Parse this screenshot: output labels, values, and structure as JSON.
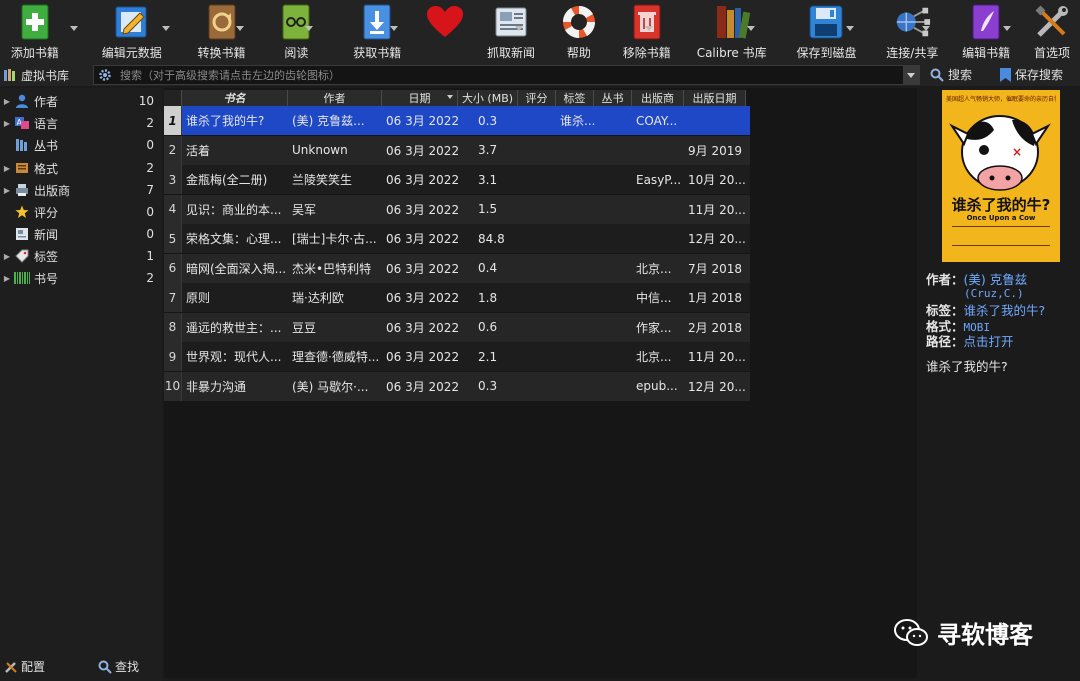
{
  "toolbar": {
    "items": [
      {
        "label": "添加书籍",
        "icon": "add-book-icon"
      },
      {
        "label": "编辑元数据",
        "icon": "edit-metadata-icon"
      },
      {
        "label": "转换书籍",
        "icon": "convert-book-icon"
      },
      {
        "label": "阅读",
        "icon": "read-book-icon"
      },
      {
        "label": "获取书籍",
        "icon": "get-books-icon"
      },
      {
        "label": "",
        "icon": "donate-heart-icon"
      },
      {
        "label": "抓取新闻",
        "icon": "fetch-news-icon"
      },
      {
        "label": "帮助",
        "icon": "help-lifebuoy-icon"
      },
      {
        "label": "移除书籍",
        "icon": "remove-books-icon"
      },
      {
        "label": "Calibre 书库",
        "icon": "calibre-library-icon"
      },
      {
        "label": "保存到磁盘",
        "icon": "save-to-disk-icon"
      },
      {
        "label": "连接/共享",
        "icon": "connect-share-icon"
      },
      {
        "label": "编辑书籍",
        "icon": "edit-book-icon"
      },
      {
        "label": "首选项",
        "icon": "preferences-icon"
      }
    ]
  },
  "search": {
    "virtual_library_label": "虚拟书库",
    "placeholder": "搜索（对于高级搜索请点击左边的齿轮图标）",
    "search_label": "搜索",
    "saved_search_label": "保存搜索"
  },
  "sidebar": {
    "items": [
      {
        "label": "作者",
        "count": "10",
        "icon": "person-icon",
        "expandable": true
      },
      {
        "label": "语言",
        "count": "2",
        "icon": "language-icon",
        "expandable": true
      },
      {
        "label": "丛书",
        "count": "0",
        "icon": "series-icon",
        "expandable": false
      },
      {
        "label": "格式",
        "count": "2",
        "icon": "format-icon",
        "expandable": true
      },
      {
        "label": "出版商",
        "count": "7",
        "icon": "publisher-icon",
        "expandable": true
      },
      {
        "label": "评分",
        "count": "0",
        "icon": "star-icon",
        "expandable": false
      },
      {
        "label": "新闻",
        "count": "0",
        "icon": "news-icon",
        "expandable": false
      },
      {
        "label": "标签",
        "count": "1",
        "icon": "tag-icon",
        "expandable": true
      },
      {
        "label": "书号",
        "count": "2",
        "icon": "barcode-icon",
        "expandable": true
      }
    ],
    "config_label": "配置",
    "find_label": "查找"
  },
  "booklist": {
    "headers": [
      "书名",
      "作者",
      "日期",
      "大小 (MB)",
      "评分",
      "标签",
      "丛书",
      "出版商",
      "出版日期"
    ],
    "rows": [
      {
        "num": "1",
        "title": "谁杀了我的牛?",
        "author": "(美) 克鲁兹...",
        "date": "06 3月 2022",
        "size": "0.3",
        "rating": "",
        "tags": "谁杀...",
        "series": "",
        "publisher": "COAY...",
        "pubdate": ""
      },
      {
        "num": "2",
        "title": "活着",
        "author": "Unknown",
        "date": "06 3月 2022",
        "size": "3.7",
        "rating": "",
        "tags": "",
        "series": "",
        "publisher": "",
        "pubdate": "9月 2019"
      },
      {
        "num": "3",
        "title": "金瓶梅(全二册)",
        "author": "兰陵笑笑生",
        "date": "06 3月 2022",
        "size": "3.1",
        "rating": "",
        "tags": "",
        "series": "",
        "publisher": "EasyP...",
        "pubdate": "10月 20..."
      },
      {
        "num": "4",
        "title": "见识：商业的本...",
        "author": "吴军",
        "date": "06 3月 2022",
        "size": "1.5",
        "rating": "",
        "tags": "",
        "series": "",
        "publisher": "",
        "pubdate": "11月 20..."
      },
      {
        "num": "5",
        "title": "荣格文集：心理...",
        "author": "[瑞士]卡尔·古...",
        "date": "06 3月 2022",
        "size": "84.8",
        "rating": "",
        "tags": "",
        "series": "",
        "publisher": "",
        "pubdate": "12月 20..."
      },
      {
        "num": "6",
        "title": "暗网(全面深入揭...",
        "author": "杰米•巴特利特",
        "date": "06 3月 2022",
        "size": "0.4",
        "rating": "",
        "tags": "",
        "series": "",
        "publisher": "北京...",
        "pubdate": "7月 2018"
      },
      {
        "num": "7",
        "title": "原则",
        "author": "瑞·达利欧",
        "date": "06 3月 2022",
        "size": "1.8",
        "rating": "",
        "tags": "",
        "series": "",
        "publisher": "中信...",
        "pubdate": "1月 2018"
      },
      {
        "num": "8",
        "title": "遥远的救世主：...",
        "author": "豆豆",
        "date": "06 3月 2022",
        "size": "0.6",
        "rating": "",
        "tags": "",
        "series": "",
        "publisher": "作家...",
        "pubdate": "2月 2018"
      },
      {
        "num": "9",
        "title": "世界观：现代人...",
        "author": "理查德·德威特...",
        "date": "06 3月 2022",
        "size": "2.1",
        "rating": "",
        "tags": "",
        "series": "",
        "publisher": "北京...",
        "pubdate": "11月 20..."
      },
      {
        "num": "10",
        "title": "非暴力沟通",
        "author": "(美) 马歇尔·...",
        "date": "06 3月 2022",
        "size": "0.3",
        "rating": "",
        "tags": "",
        "series": "",
        "publisher": "epub...",
        "pubdate": "12月 20..."
      }
    ]
  },
  "details": {
    "cover": {
      "top_text": "美国超人气畅销大师，催眠要命的亲历自传",
      "title": "谁杀了我的牛?",
      "subtitle": "Once Upon a Cow"
    },
    "author_label": "作者：",
    "author_value": "(美) 克鲁兹",
    "author_value2": "(Cruz,C.)",
    "tags_label": "标签：",
    "tags_value": "谁杀了我的牛?",
    "format_label": "格式：",
    "format_value": "MOBI",
    "path_label": "路径：",
    "path_value": "点击打开",
    "comment": "谁杀了我的牛?"
  },
  "watermark": "寻软博客",
  "colors": {
    "selection": "#1f48c7",
    "link": "#6fa8ff",
    "cover_bg": "#f3b51c"
  }
}
